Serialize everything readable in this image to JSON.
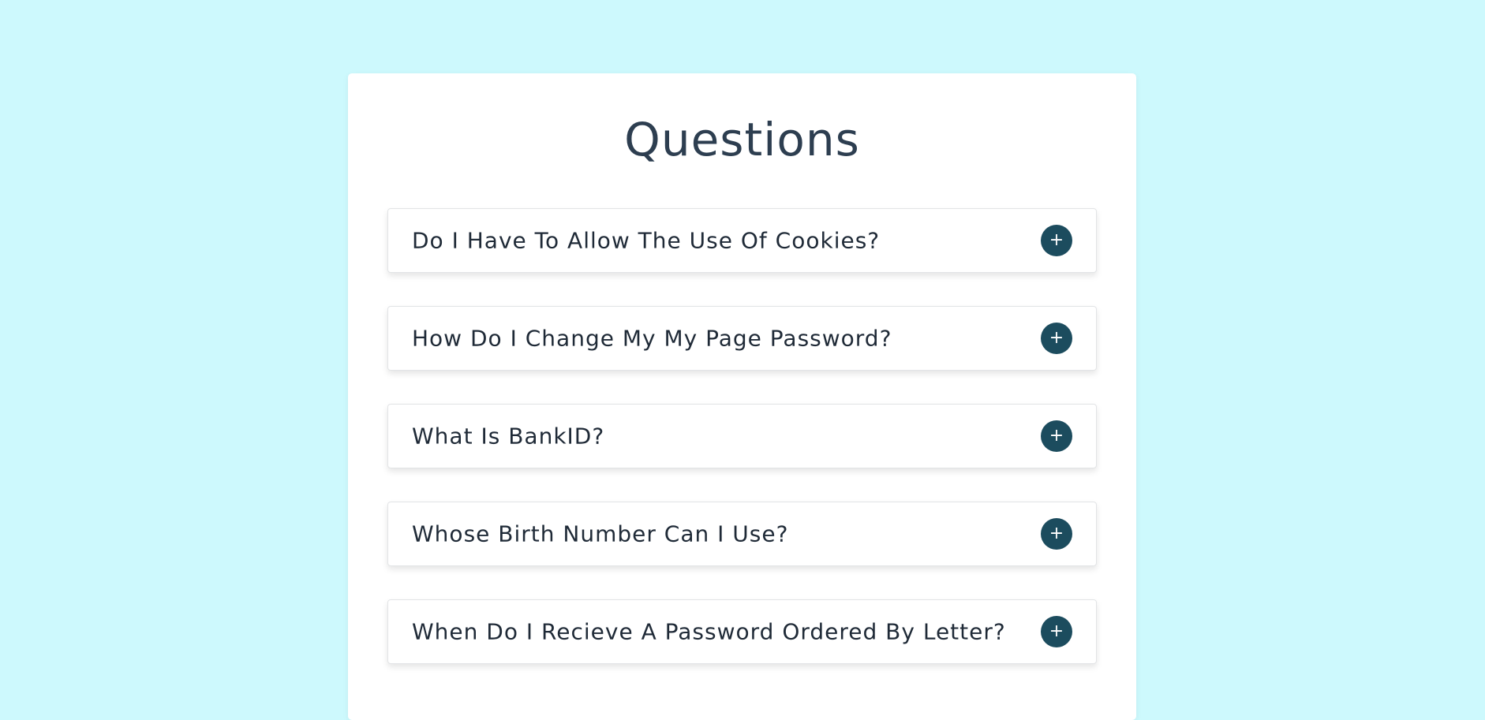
{
  "page": {
    "title": "Questions",
    "background_color": "#cdf9fd",
    "accent_color": "#1c4c5e"
  },
  "faq": {
    "items": [
      {
        "question": "Do I Have To Allow The Use Of Cookies?",
        "toggle_icon": "plus-icon",
        "toggle_symbol": "+"
      },
      {
        "question": "How Do I Change My My Page Password?",
        "toggle_icon": "plus-icon",
        "toggle_symbol": "+"
      },
      {
        "question": "What Is BankID?",
        "toggle_icon": "plus-icon",
        "toggle_symbol": "+"
      },
      {
        "question": "Whose Birth Number Can I Use?",
        "toggle_icon": "plus-icon",
        "toggle_symbol": "+"
      },
      {
        "question": "When Do I Recieve A Password Ordered By Letter?",
        "toggle_icon": "plus-icon",
        "toggle_symbol": "+"
      }
    ]
  }
}
